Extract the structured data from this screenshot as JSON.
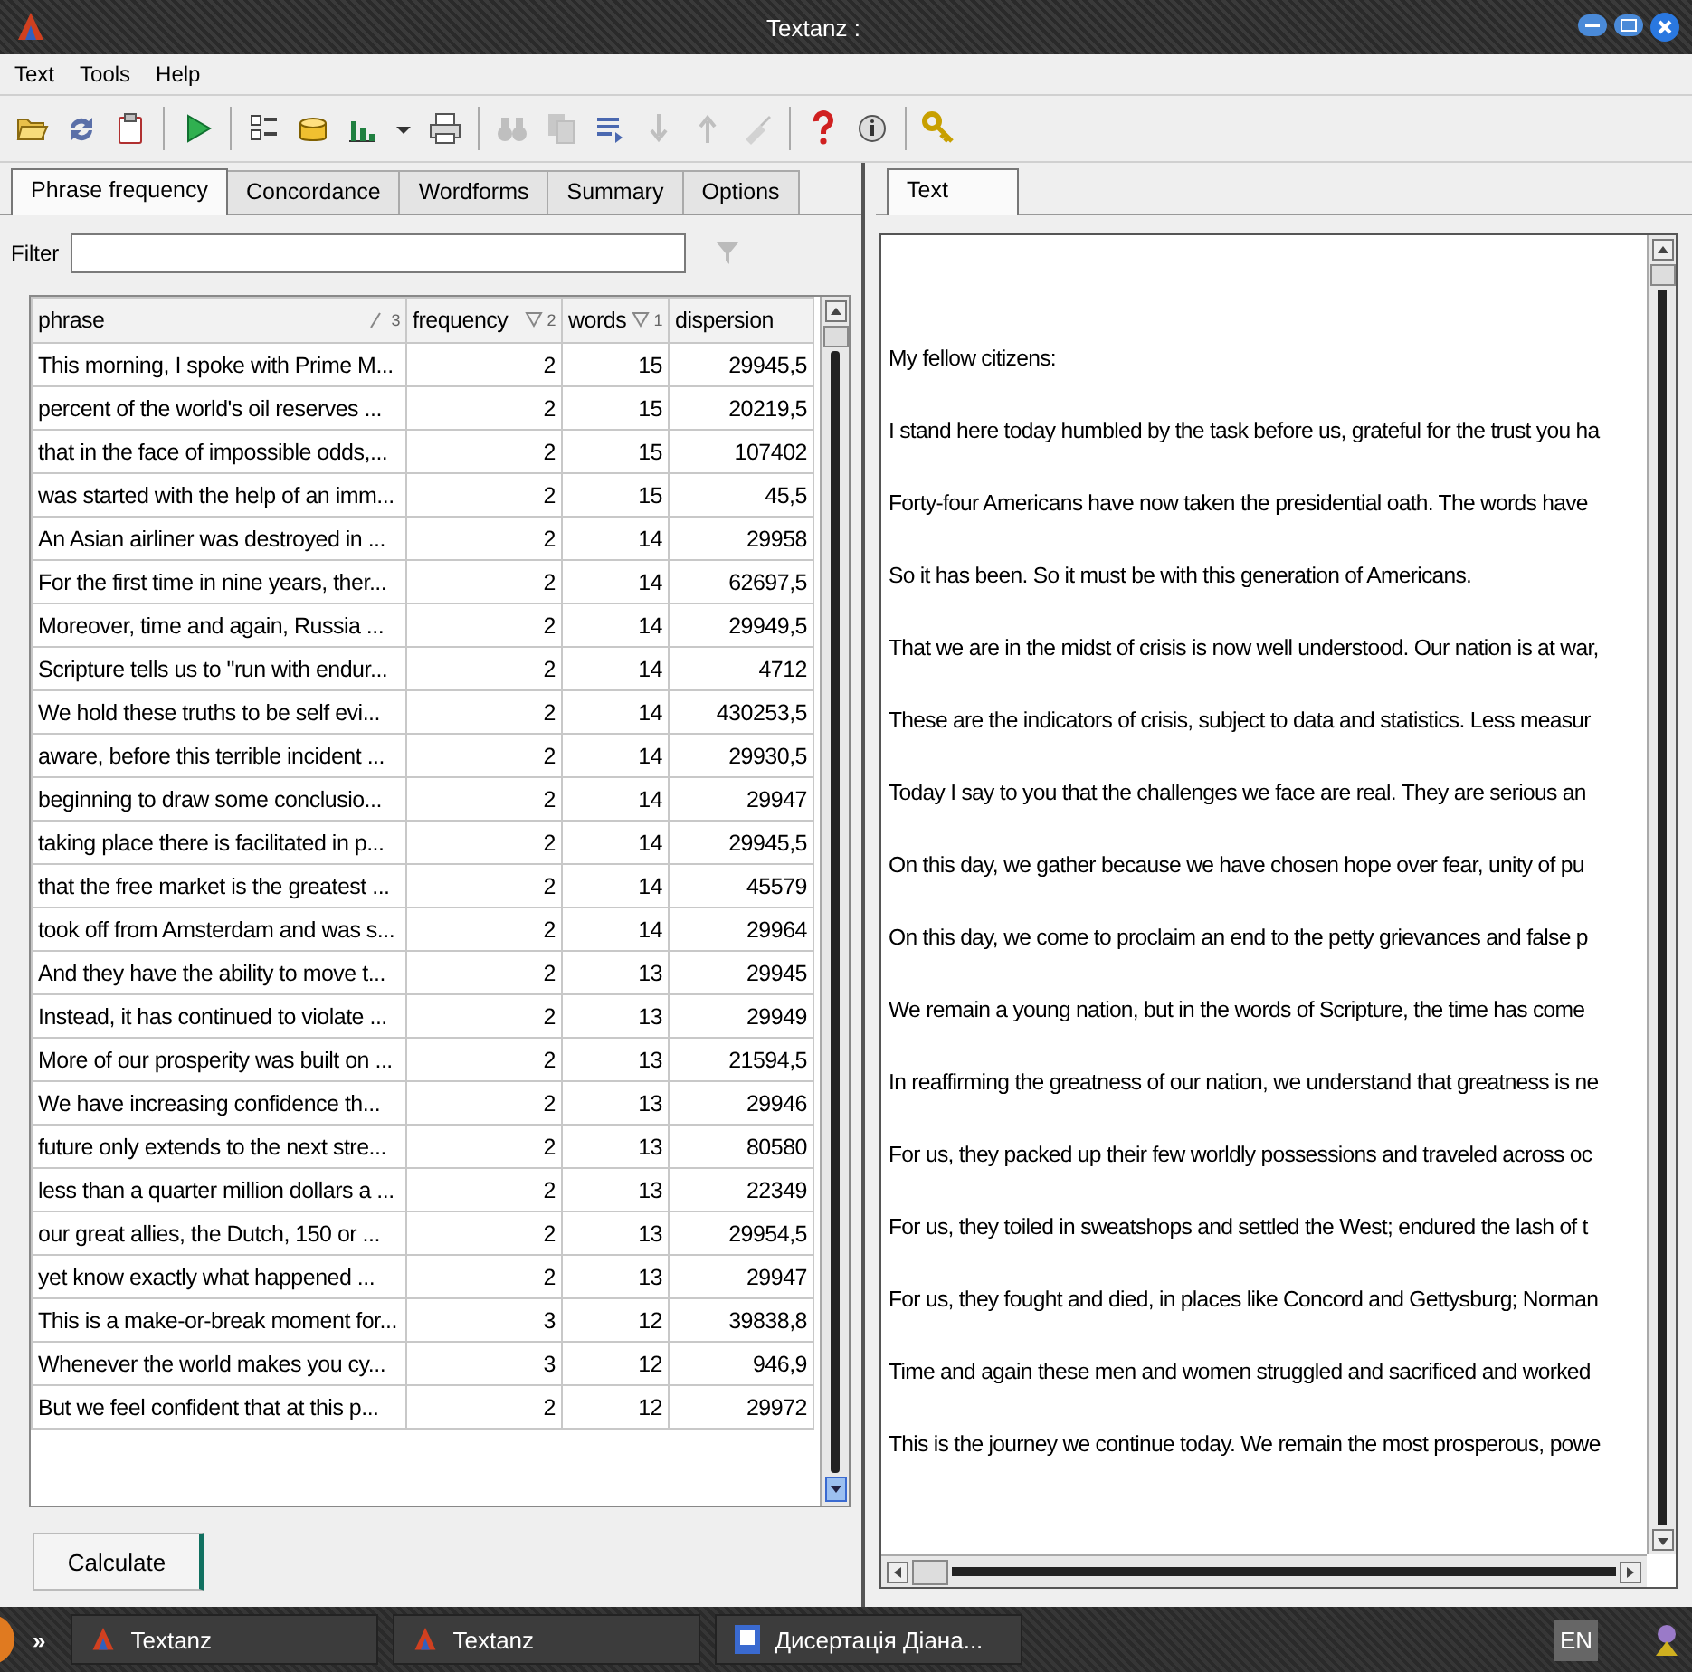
{
  "window": {
    "title": "Textanz :"
  },
  "menu": [
    {
      "label": "Text"
    },
    {
      "label": "Tools"
    },
    {
      "label": "Help"
    }
  ],
  "toolbar": [
    {
      "kind": "open",
      "disabled": false
    },
    {
      "kind": "refresh",
      "disabled": false
    },
    {
      "kind": "clipboard",
      "disabled": false
    },
    {
      "kind": "separator"
    },
    {
      "kind": "play",
      "disabled": false
    },
    {
      "kind": "separator"
    },
    {
      "kind": "list",
      "disabled": false
    },
    {
      "kind": "database",
      "disabled": false
    },
    {
      "kind": "chart",
      "disabled": false
    },
    {
      "kind": "caret",
      "disabled": false
    },
    {
      "kind": "printer",
      "disabled": false
    },
    {
      "kind": "separator"
    },
    {
      "kind": "binoculars",
      "disabled": true
    },
    {
      "kind": "pages",
      "disabled": true
    },
    {
      "kind": "lines",
      "disabled": false
    },
    {
      "kind": "down",
      "disabled": true
    },
    {
      "kind": "up",
      "disabled": true
    },
    {
      "kind": "brush",
      "disabled": true
    },
    {
      "kind": "separator"
    },
    {
      "kind": "help",
      "disabled": false
    },
    {
      "kind": "info",
      "disabled": false
    },
    {
      "kind": "separator"
    },
    {
      "kind": "key",
      "disabled": false
    }
  ],
  "left_tabs": [
    {
      "label": "Phrase frequency",
      "selected": true
    },
    {
      "label": "Concordance",
      "selected": false
    },
    {
      "label": "Wordforms",
      "selected": false
    },
    {
      "label": "Summary",
      "selected": false
    },
    {
      "label": "Options",
      "selected": false
    }
  ],
  "filter": {
    "label": "Filter"
  },
  "table": {
    "columns": [
      {
        "label": "phrase",
        "sort_ascending": true,
        "sort_rank": "3"
      },
      {
        "label": "frequency",
        "sort_ascending": false,
        "sort_rank": "2"
      },
      {
        "label": "words",
        "sort_ascending": false,
        "sort_rank": "1"
      },
      {
        "label": "dispersion"
      }
    ],
    "rows": [
      [
        "This morning, I spoke with Prime M...",
        "2",
        "15",
        "29945,5"
      ],
      [
        "percent of the world's oil reserves ...",
        "2",
        "15",
        "20219,5"
      ],
      [
        "that in the face of impossible odds,...",
        "2",
        "15",
        "107402"
      ],
      [
        "was started with the help of an imm...",
        "2",
        "15",
        "45,5"
      ],
      [
        "An Asian airliner was destroyed in ...",
        "2",
        "14",
        "29958"
      ],
      [
        "For the first time in nine years, ther...",
        "2",
        "14",
        "62697,5"
      ],
      [
        "Moreover, time and again, Russia ...",
        "2",
        "14",
        "29949,5"
      ],
      [
        "Scripture tells us to \"run with endur...",
        "2",
        "14",
        "4712"
      ],
      [
        "We hold these truths to be self evi...",
        "2",
        "14",
        "430253,5"
      ],
      [
        "aware, before this terrible incident ...",
        "2",
        "14",
        "29930,5"
      ],
      [
        "beginning to draw some conclusio...",
        "2",
        "14",
        "29947"
      ],
      [
        "taking place there is facilitated in p...",
        "2",
        "14",
        "29945,5"
      ],
      [
        "that the free market is the greatest ...",
        "2",
        "14",
        "45579"
      ],
      [
        "took off from Amsterdam and was s...",
        "2",
        "14",
        "29964"
      ],
      [
        "And they have the ability to move t...",
        "2",
        "13",
        "29945"
      ],
      [
        "Instead, it has continued to violate ...",
        "2",
        "13",
        "29949"
      ],
      [
        "More of our prosperity was built on ...",
        "2",
        "13",
        "21594,5"
      ],
      [
        "We have increasing confidence th...",
        "2",
        "13",
        "29946"
      ],
      [
        "future only extends to the next stre...",
        "2",
        "13",
        "80580"
      ],
      [
        "less than a quarter million dollars a ...",
        "2",
        "13",
        "22349"
      ],
      [
        "our great allies, the Dutch, 150 or ...",
        "2",
        "13",
        "29954,5"
      ],
      [
        "yet know exactly what happened ...",
        "2",
        "13",
        "29947"
      ],
      [
        "This is a make-or-break moment for...",
        "3",
        "12",
        "39838,8"
      ],
      [
        "Whenever the world makes you cy...",
        "3",
        "12",
        "946,9"
      ],
      [
        "But we feel confident that at this p...",
        "2",
        "12",
        "29972"
      ]
    ]
  },
  "calculate_button": "Calculate",
  "right_tabs": [
    {
      "label": "Text",
      "selected": true
    }
  ],
  "text_lines": [
    "My fellow citizens:",
    "I stand here today humbled by the task before us, grateful for the trust you ha",
    "Forty-four Americans have now taken the presidential oath. The words have",
    "So it has been. So it must be with this generation of Americans.",
    "That we are in the midst of crisis is now well understood. Our nation is at war,",
    "These are the indicators of crisis, subject to data and statistics. Less measur",
    "Today I say to you that the challenges we face are real. They are serious an",
    "On this day, we gather because we have chosen hope over fear, unity of pu",
    "On this day, we come to proclaim an end to the petty grievances and false p",
    "We remain a young nation, but in the words of Scripture, the time has come",
    "In reaffirming the greatness of our nation, we understand that greatness is ne",
    "For us, they packed up their few worldly possessions and traveled across oc",
    "For us, they toiled in sweatshops and settled the West; endured the lash of t",
    "For us, they fought and died, in places like Concord and Gettysburg; Norman",
    "Time and again these men and women struggled and sacrificed and worked",
    "This is the journey we continue today. We remain the most prosperous, powe"
  ],
  "taskbar": {
    "chevron": "»",
    "items": [
      {
        "label": "Textanz",
        "kind": "app"
      },
      {
        "label": "Textanz",
        "kind": "app"
      },
      {
        "label": "Дисертація Діана...",
        "kind": "word"
      }
    ],
    "language": "EN"
  }
}
